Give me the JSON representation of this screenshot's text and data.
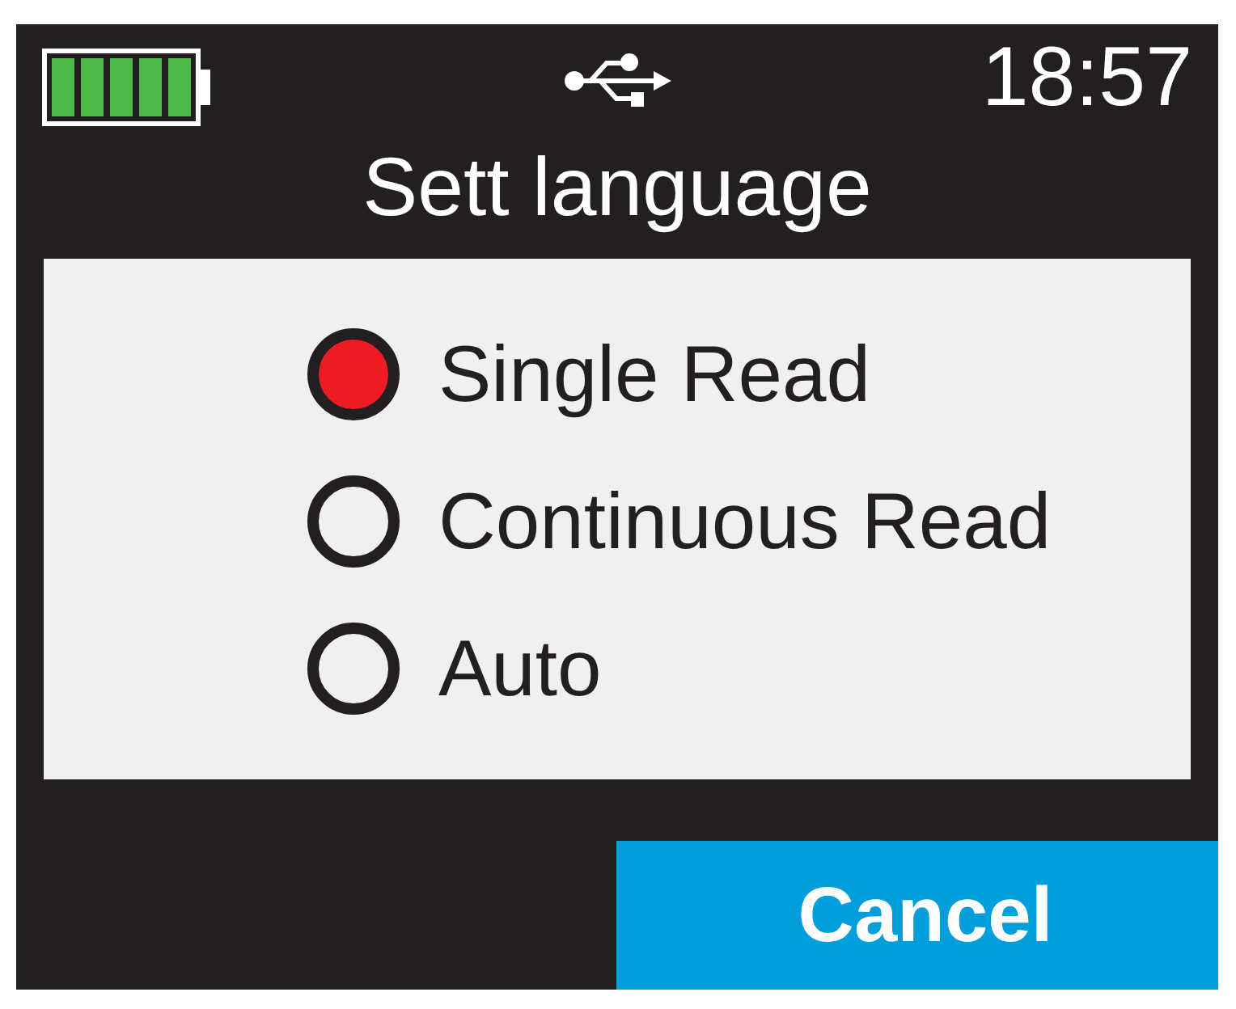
{
  "status_bar": {
    "time": "18:57"
  },
  "title": "Sett language",
  "options": [
    {
      "label": "Single Read",
      "selected": true
    },
    {
      "label": "Continuous Read",
      "selected": false
    },
    {
      "label": "Auto",
      "selected": false
    }
  ],
  "cancel_button": {
    "label": "Cancel"
  }
}
